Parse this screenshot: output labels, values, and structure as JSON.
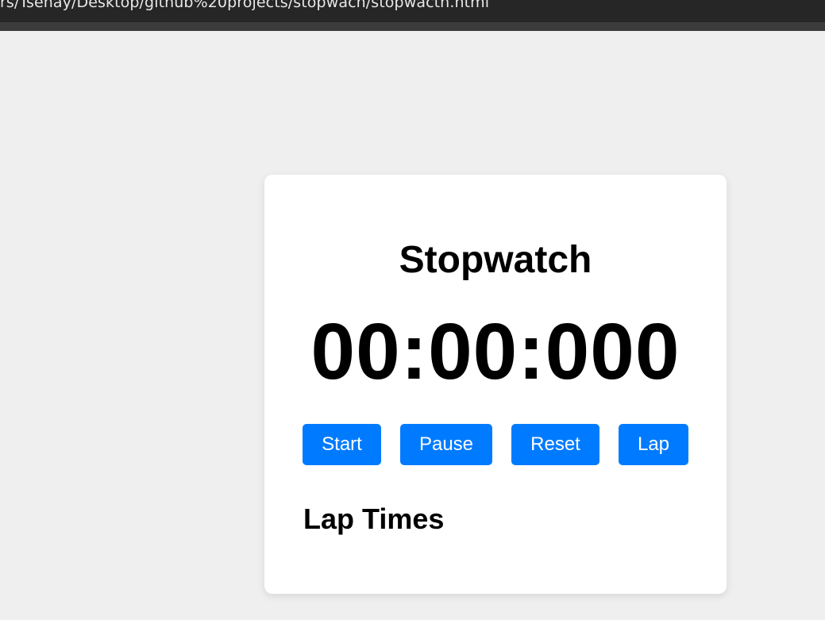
{
  "browser": {
    "url_text": "rs/Tsehay/Desktop/github%20projects/stopwach/stopwacth.html"
  },
  "app": {
    "title": "Stopwatch",
    "time_display": "00:00:000",
    "buttons": {
      "start": "Start",
      "pause": "Pause",
      "reset": "Reset",
      "lap": "Lap"
    },
    "lap_heading": "Lap Times",
    "laps": []
  },
  "colors": {
    "background": "#efefef",
    "card": "#ffffff",
    "button": "#007bff",
    "button_text": "#ffffff",
    "text": "#000000"
  }
}
